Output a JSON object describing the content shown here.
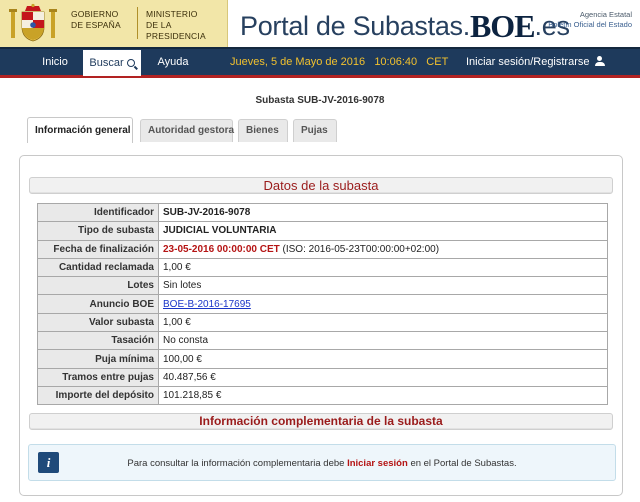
{
  "header": {
    "gov_line1": "GOBIERNO",
    "gov_line2": "DE ESPAÑA",
    "ministry_line1": "MINISTERIO",
    "ministry_line2": "DE LA PRESIDENCIA",
    "portal_prefix": "Portal de Subastas.",
    "portal_brand": "BOE",
    "portal_suffix": ".es",
    "agency_line1": "Agencia Estatal",
    "agency_line2": "Boletín Oficial del Estado"
  },
  "nav": {
    "inicio": "Inicio",
    "buscar": "Buscar",
    "ayuda": "Ayuda",
    "datetime": "Jueves, 5 de Mayo de 2016   10:06:40   CET",
    "login": "Iniciar sesión/Registrarse"
  },
  "subasta_title": "Subasta SUB-JV-2016-9078",
  "tabs": [
    {
      "label": "Información general",
      "active": true
    },
    {
      "label": "Autoridad gestora",
      "active": false
    },
    {
      "label": "Bienes",
      "active": false
    },
    {
      "label": "Pujas",
      "active": false
    }
  ],
  "section_datos": "Datos de la subasta",
  "fields": [
    {
      "key": "Identificador",
      "value": "SUB-JV-2016-9078"
    },
    {
      "key": "Tipo de subasta",
      "value": "JUDICIAL VOLUNTARIA"
    },
    {
      "key": "Fecha de finalización",
      "value_date": "23-05-2016 00:00:00 CET",
      "value_iso": "(ISO: 2016-05-23T00:00:00+02:00)"
    },
    {
      "key": "Cantidad reclamada",
      "value": "1,00 €"
    },
    {
      "key": "Lotes",
      "value": "Sin lotes"
    },
    {
      "key": "Anuncio BOE",
      "value": "BOE-B-2016-17695"
    },
    {
      "key": "Valor subasta",
      "value": "1,00 €"
    },
    {
      "key": "Tasación",
      "value": "No consta"
    },
    {
      "key": "Puja mínima",
      "value": "100,00 €"
    },
    {
      "key": "Tramos entre pujas",
      "value": "40.487,56 €"
    },
    {
      "key": "Importe del depósito",
      "value": "101.218,85 €"
    }
  ],
  "section_complementaria": "Información complementaria de la subasta",
  "info": {
    "text_before": "Para consultar la información complementaria debe",
    "link": "Iniciar sesión",
    "text_after": "en el Portal de Subastas."
  },
  "colors": {
    "header_band": "#f2e6a8",
    "navbar": "#1e3a5c",
    "navbar_accent": "#b22222",
    "date_text": "#f2c12e",
    "section_title": "#9a1b1b",
    "link": "#1a35c8"
  }
}
